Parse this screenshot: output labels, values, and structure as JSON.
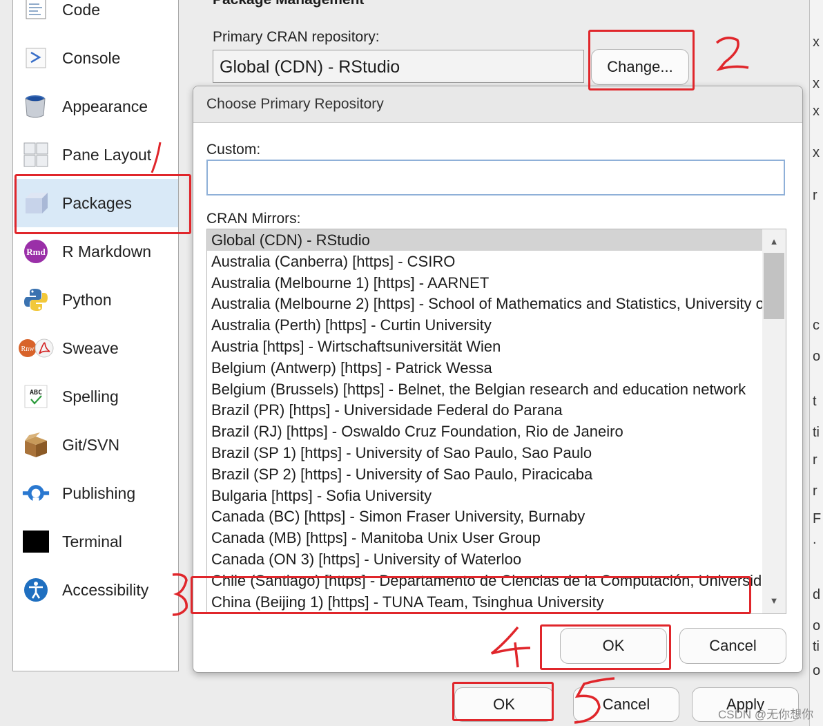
{
  "sidebar": {
    "items": [
      {
        "label": "Code",
        "icon": "code-icon"
      },
      {
        "label": "Console",
        "icon": "console-icon"
      },
      {
        "label": "Appearance",
        "icon": "paint-bucket-icon"
      },
      {
        "label": "Pane Layout",
        "icon": "pane-layout-icon"
      },
      {
        "label": "Packages",
        "icon": "package-box-icon",
        "selected": true
      },
      {
        "label": "R Markdown",
        "icon": "rmarkdown-icon",
        "badge": "Rmd"
      },
      {
        "label": "Python",
        "icon": "python-icon"
      },
      {
        "label": "Sweave",
        "icon": "sweave-icon",
        "badge": "Rnw"
      },
      {
        "label": "Spelling",
        "icon": "spelling-icon",
        "badge": "ABC"
      },
      {
        "label": "Git/SVN",
        "icon": "git-box-icon"
      },
      {
        "label": "Publishing",
        "icon": "publishing-icon"
      },
      {
        "label": "Terminal",
        "icon": "terminal-icon"
      },
      {
        "label": "Accessibility",
        "icon": "accessibility-icon"
      }
    ]
  },
  "package_management": {
    "heading": "Package Management",
    "primary_label": "Primary CRAN repository:",
    "primary_value": "Global (CDN) - RStudio",
    "change_button": "Change..."
  },
  "repo_dialog": {
    "title": "Choose Primary Repository",
    "custom_label": "Custom:",
    "custom_value": "",
    "mirrors_label": "CRAN Mirrors:",
    "selected_index": 0,
    "mirrors": [
      "Global (CDN) - RStudio",
      "Australia (Canberra) [https] - CSIRO",
      "Australia (Melbourne 1) [https] - AARNET",
      "Australia (Melbourne 2) [https] - School of Mathematics and Statistics, University of Melbourne",
      "Australia (Perth) [https] - Curtin University",
      "Austria [https] - Wirtschaftsuniversität Wien",
      "Belgium (Antwerp) [https] - Patrick Wessa",
      "Belgium (Brussels) [https] - Belnet, the Belgian research and education network",
      "Brazil (PR) [https] - Universidade Federal do Parana",
      "Brazil (RJ) [https] - Oswaldo Cruz Foundation, Rio de Janeiro",
      "Brazil (SP 1) [https] - University of Sao Paulo, Sao Paulo",
      "Brazil (SP 2) [https] - University of Sao Paulo, Piracicaba",
      "Bulgaria [https] - Sofia University",
      "Canada (BC) [https] - Simon Fraser University, Burnaby",
      "Canada (MB) [https] - Manitoba Unix User Group",
      "Canada (ON 3) [https] - University of Waterloo",
      "Chile (Santiago) [https] - Departamento de Ciencias de la Computación, Universidad de Chile",
      "China (Beijing 1) [https] - TUNA Team, Tsinghua University"
    ],
    "ok_button": "OK",
    "cancel_button": "Cancel"
  },
  "options_buttons": {
    "ok": "OK",
    "cancel": "Cancel",
    "apply": "Apply"
  },
  "right_strip_chars": [
    "x",
    "x",
    "x",
    "x",
    "r",
    "c",
    "o",
    "t",
    "ti",
    "r",
    "r",
    "F",
    ".",
    "d",
    "o",
    "ti",
    "o"
  ],
  "watermark": "CSDN @无你想你",
  "colors": {
    "annotation_red": "#e0262b",
    "selected_sidebar": "#d9e9f7",
    "selected_row": "#d3d3d3"
  }
}
